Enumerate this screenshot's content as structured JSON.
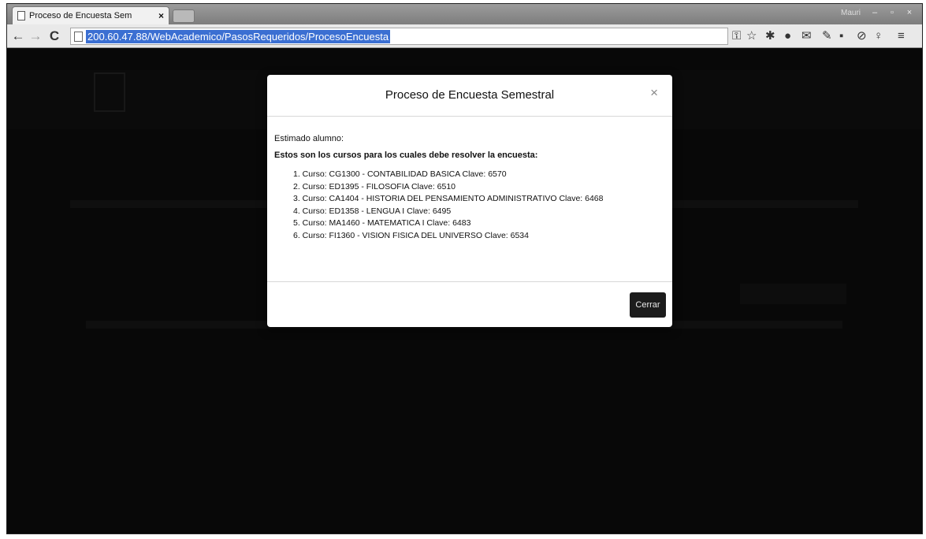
{
  "browser": {
    "tab_title": "Proceso de Encuesta Sem",
    "tab_close": "×",
    "url": "200.60.47.88/WebAcademico/PasosRequeridos/ProcesoEncuesta",
    "user_label": "Mauri",
    "window_controls": [
      "–",
      "▫",
      "×"
    ],
    "nav": {
      "back": "←",
      "forward": "→",
      "reload": "C"
    },
    "extensions": [
      "key-icon",
      "star-icon",
      "gear-icon",
      "record-icon",
      "gmail-icon",
      "pen-icon",
      "extension-icon",
      "block-icon",
      "person-icon",
      "menu-icon"
    ]
  },
  "modal": {
    "title": "Proceso de Encuesta Semestral",
    "close_symbol": "×",
    "greeting": "Estimado alumno:",
    "intro": "Estos son los cursos para los cuales debe resolver la encuesta:",
    "courses": [
      "1. Curso: CG1300 - CONTABILIDAD BASICA Clave: 6570",
      "2. Curso: ED1395 - FILOSOFIA Clave: 6510",
      "3. Curso: CA1404 - HISTORIA DEL PENSAMIENTO ADMINISTRATIVO Clave: 6468",
      "4. Curso: ED1358 - LENGUA I Clave: 6495",
      "5. Curso: MA1460 - MATEMATICA I Clave: 6483",
      "6. Curso: FI1360 - VISION FISICA DEL UNIVERSO Clave: 6534"
    ],
    "button_label": "Cerrar"
  }
}
